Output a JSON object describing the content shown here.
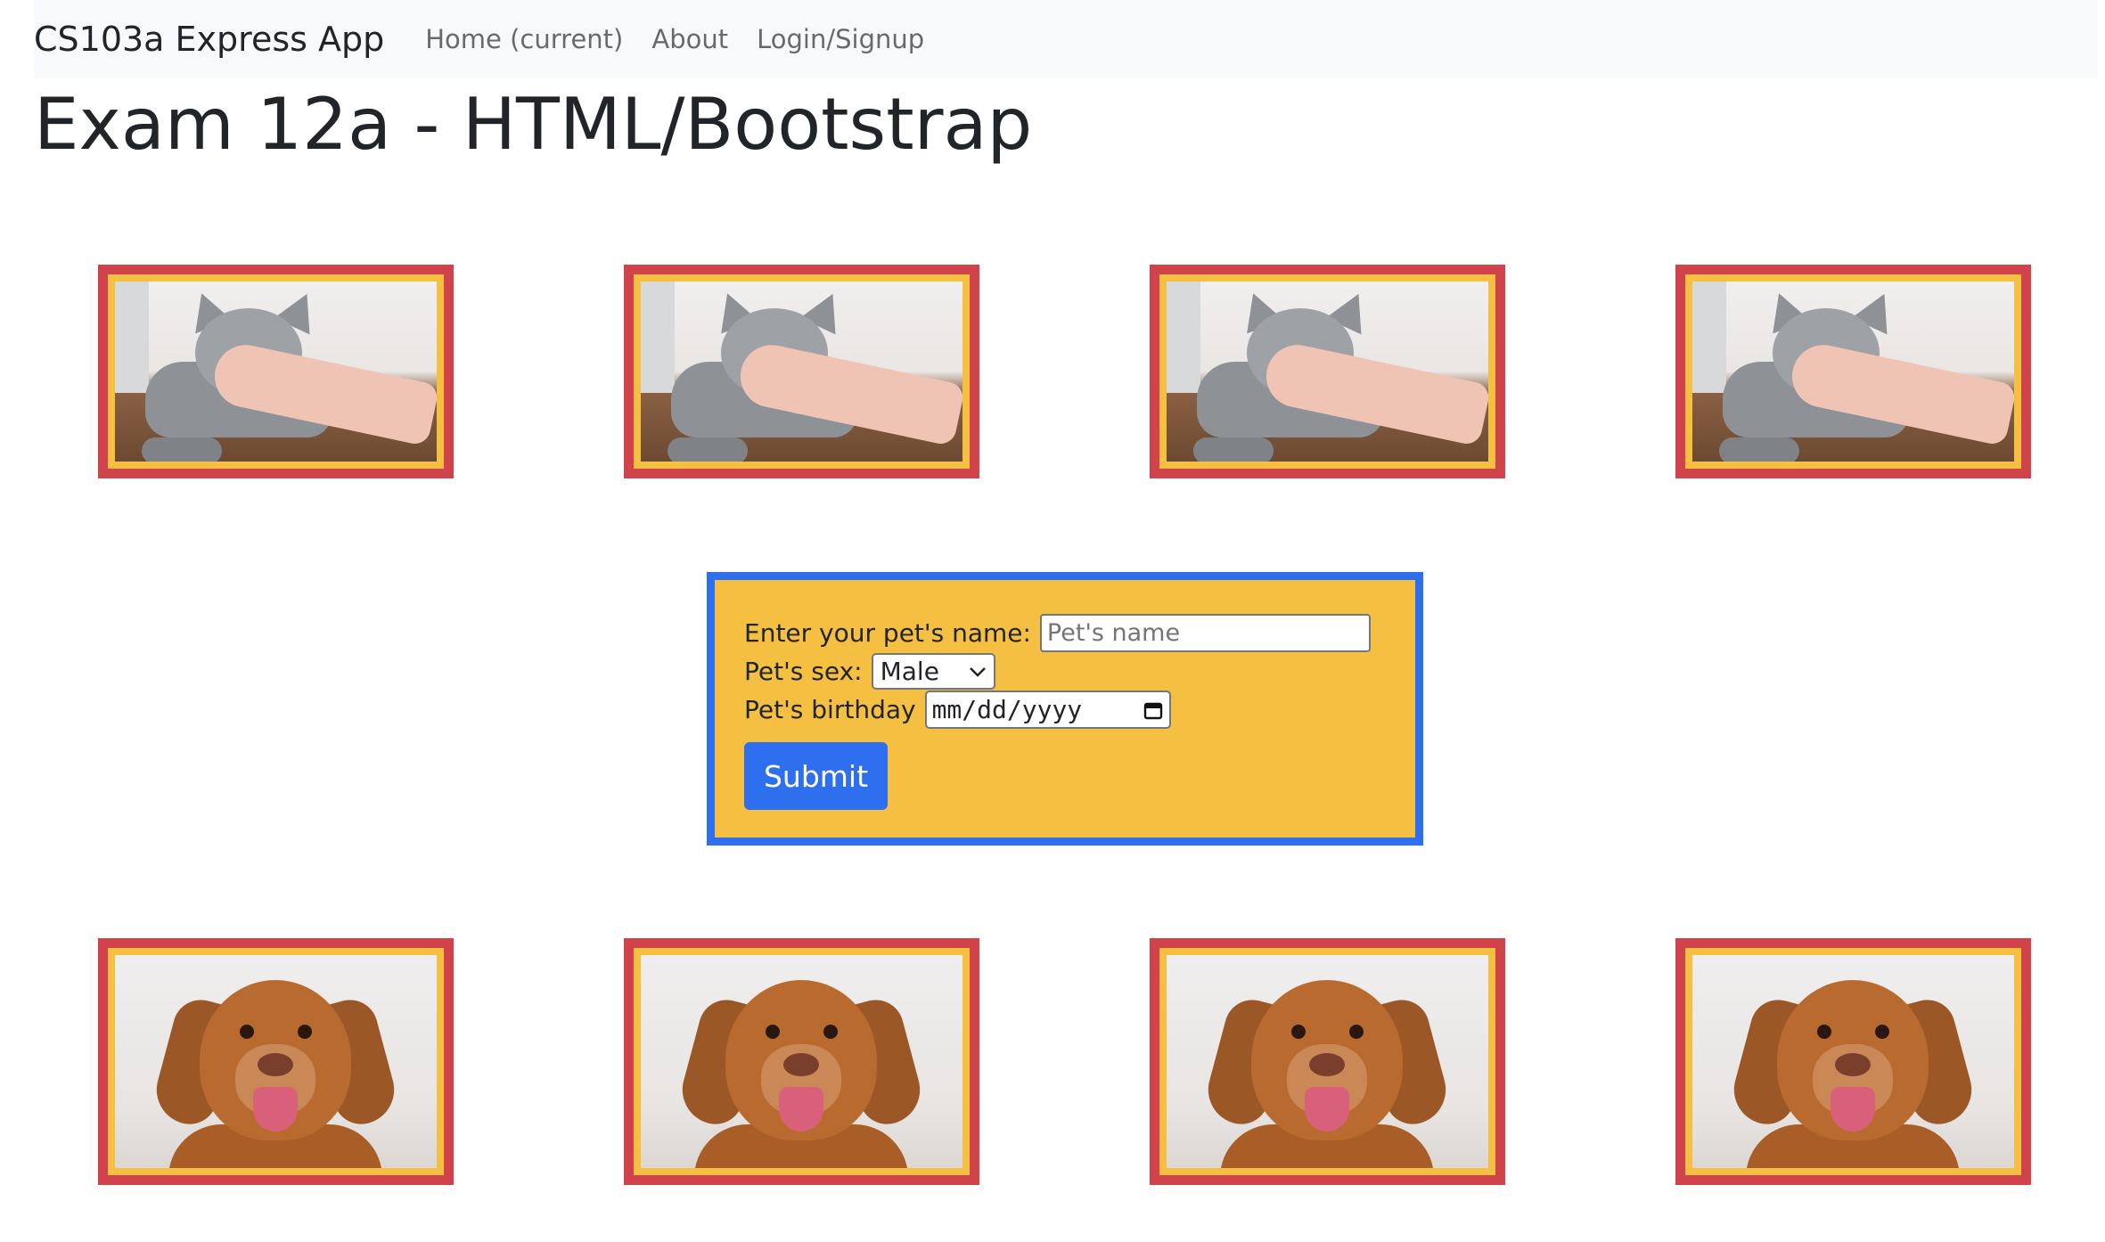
{
  "navbar": {
    "brand": "CS103a Express App",
    "links": [
      "Home (current)",
      "About",
      "Login/Signup"
    ]
  },
  "page": {
    "title": "Exam 12a - HTML/Bootstrap"
  },
  "gallery": {
    "cat_count": 4,
    "dog_count": 4
  },
  "form": {
    "name_label": "Enter your pet's name:",
    "name_placeholder": "Pet's name",
    "sex_label": "Pet's sex:",
    "sex_value": "Male",
    "birthday_label": "Pet's birthday",
    "birthday_placeholder": "mm/dd/yyyy",
    "submit_label": "Submit"
  },
  "colors": {
    "frame_outer": "#d1434a",
    "frame_inner": "#f5bf42",
    "form_border": "#2e6ff0",
    "button": "#2e6ff0"
  },
  "icons": {
    "select": "chevron-down-icon",
    "date": "calendar-icon"
  }
}
